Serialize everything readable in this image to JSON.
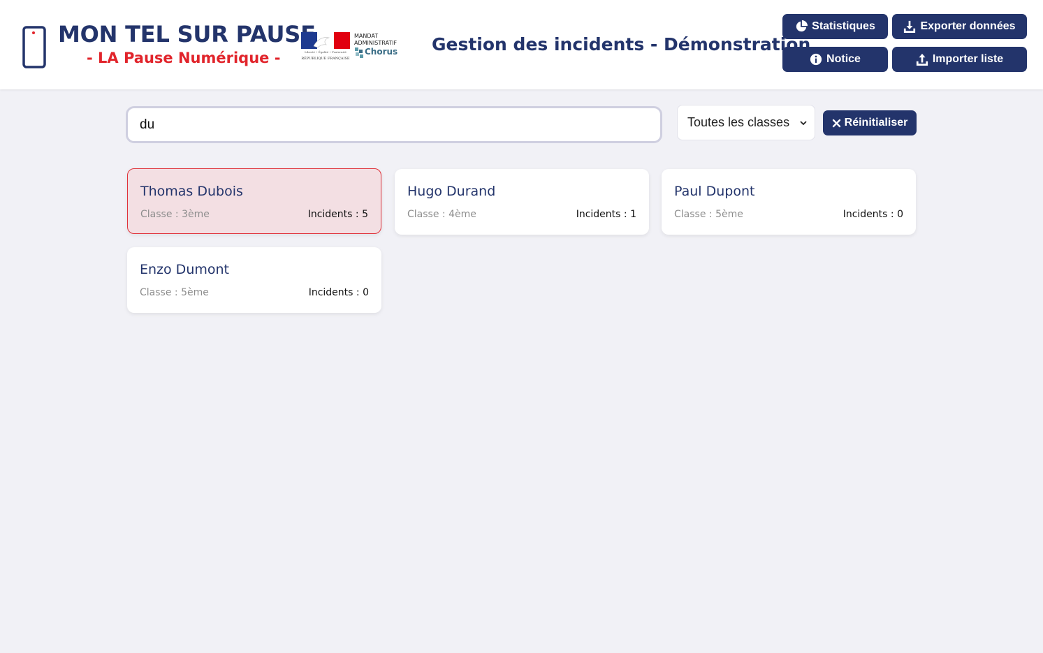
{
  "brand": {
    "title": "MON TEL SUR PAUSE",
    "subtitle": "- LA Pause Numérique -",
    "marianne_motto": "Liberté • Égalité • Fraternité",
    "marianne_rf": "RÉPUBLIQUE FRANÇAISE",
    "mandat_line1": "MANDAT",
    "mandat_line2": "ADMINISTRATIF",
    "chorus": "Chorus"
  },
  "header": {
    "title": "Gestion des incidents - Démonstration",
    "buttons": {
      "statistiques": "Statistiques",
      "exporter": "Exporter données",
      "notice": "Notice",
      "importer": "Importer liste"
    }
  },
  "filters": {
    "search_value": "du",
    "class_selected": "Toutes les classes",
    "reset_label": "Réinitialiser"
  },
  "students": [
    {
      "name": "Thomas Dubois",
      "class_label": "Classe :",
      "class": "3ème",
      "incidents_label": "Incidents :",
      "incidents": "5",
      "alert": true
    },
    {
      "name": "Hugo Durand",
      "class_label": "Classe :",
      "class": "4ème",
      "incidents_label": "Incidents :",
      "incidents": "1",
      "alert": false
    },
    {
      "name": "Paul Dupont",
      "class_label": "Classe :",
      "class": "5ème",
      "incidents_label": "Incidents :",
      "incidents": "0",
      "alert": false
    },
    {
      "name": "Enzo Dumont",
      "class_label": "Classe :",
      "class": "5ème",
      "incidents_label": "Incidents :",
      "incidents": "0",
      "alert": false
    }
  ],
  "colors": {
    "primary": "#23346b",
    "accent_red": "#e1242b",
    "background": "#f1f1f6",
    "alert_card_bg": "#f3dfe3",
    "alert_card_border": "#e0323a"
  },
  "icons": {
    "statistiques": "pie-chart-icon",
    "exporter": "download-icon",
    "notice": "info-icon",
    "importer": "upload-icon",
    "reset": "close-icon",
    "select": "chevron-down-icon",
    "logo": "phone-icon"
  }
}
